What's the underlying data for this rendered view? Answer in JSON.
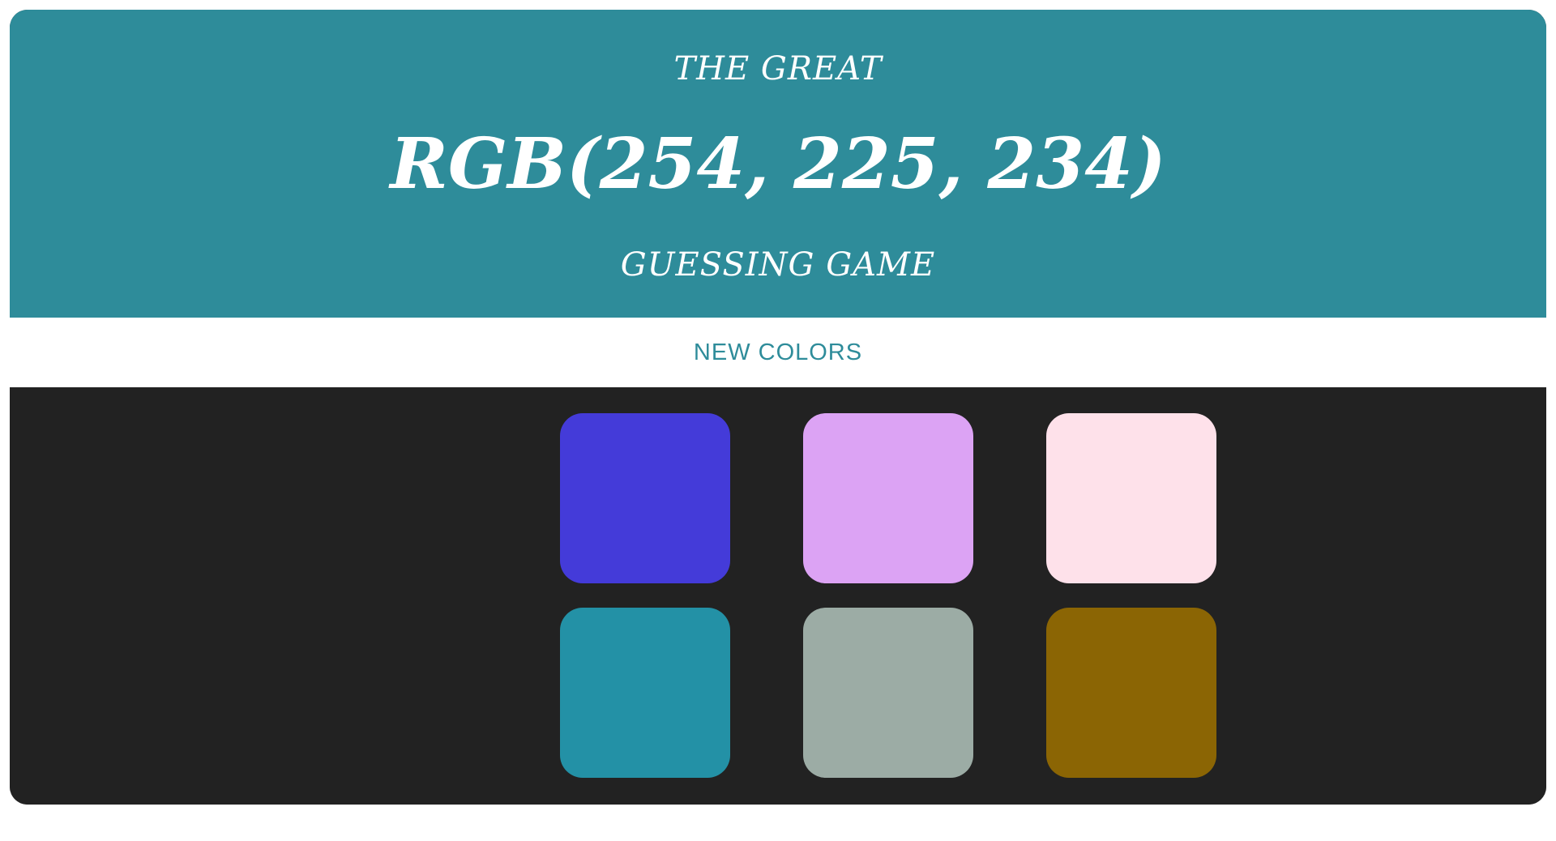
{
  "header": {
    "top_line": "THE GREAT",
    "target_color": "RGB(254, 225, 234)",
    "bottom_line": "GUESSING GAME",
    "background": "#2e8c9a"
  },
  "controls": {
    "new_colors_label": "NEW COLORS",
    "accent": "#2e8c9a"
  },
  "board": {
    "background": "#222222",
    "squares": [
      {
        "color": "#443bd9"
      },
      {
        "color": "#dca3f4"
      },
      {
        "color": "#fee1ea"
      },
      {
        "color": "#2391a6"
      },
      {
        "color": "#9caca5"
      },
      {
        "color": "#8b6504"
      }
    ]
  }
}
